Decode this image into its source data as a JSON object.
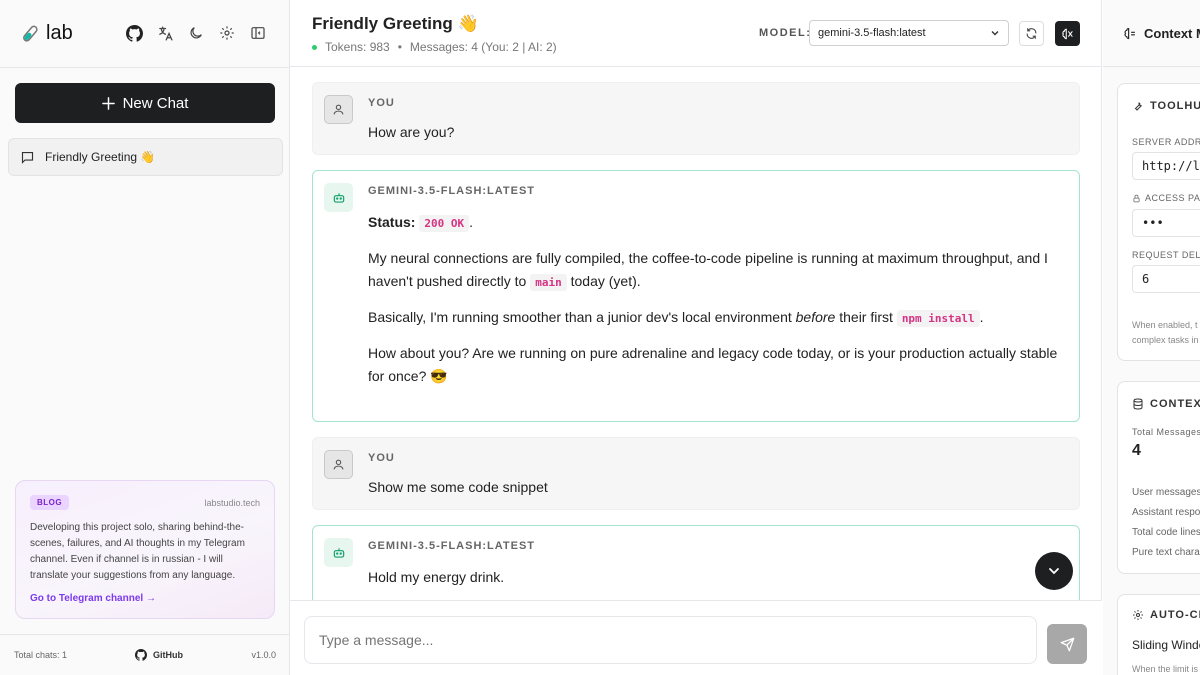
{
  "sidebar": {
    "brand": "lab",
    "new_chat": "New Chat",
    "chats": [
      {
        "title": "Friendly Greeting 👋"
      }
    ],
    "blog": {
      "badge": "BLOG",
      "site": "labstudio.tech",
      "text": "Developing this project solo, sharing behind-the-scenes, failures, and AI thoughts in my Telegram channel. Even if channel is in russian - I will translate your suggestions from any language.",
      "link": "Go to Telegram channel →"
    },
    "footer": {
      "total": "Total chats: 1",
      "github": "GitHub",
      "version": "v1.0.0"
    }
  },
  "header": {
    "title": "Friendly Greeting 👋",
    "tokens": "Tokens: 983",
    "messages": "Messages: 4 (You: 2 | AI: 2)",
    "model_label": "MODEL:",
    "model_value": "gemini-3.5-flash:latest"
  },
  "messages": [
    {
      "role": "YOU",
      "text": "How are you?"
    },
    {
      "role": "GEMINI-3.5-FLASH:LATEST",
      "status_label": "Status:",
      "status_code": "200 OK",
      "p1a": "My neural connections are fully compiled, the coffee-to-code pipeline is running at maximum throughput, and I haven't pushed directly to",
      "p1code": "main",
      "p1b": "today (yet).",
      "p2a": "Basically, I'm running smoother than a junior dev's local environment",
      "p2em": "before",
      "p2b": "their first",
      "p2code": "npm install",
      "p3": "How about you? Are we running on pure adrenaline and legacy code today, or is your production actually stable for once? 😎"
    },
    {
      "role": "YOU",
      "text": "Show me some code snippet"
    },
    {
      "role": "GEMINI-3.5-FLASH:LATEST",
      "text": "Hold my energy drink."
    }
  ],
  "input": {
    "placeholder": "Type a message..."
  },
  "right_panel": {
    "title": "Context M",
    "toolhub": {
      "title": "TOOLHUB",
      "server_label": "SERVER ADDRE",
      "server_value": "http://lo",
      "pass_label": "ACCESS PAS",
      "pass_value": "•••",
      "delay_label": "REQUEST DELA",
      "delay_value": "6",
      "hint1": "When enabled, t",
      "hint2": "complex tasks in"
    },
    "context": {
      "title": "CONTEXT",
      "total_label": "Total Messages",
      "total_value": "4",
      "user_msgs": "User messages",
      "assistant": "Assistant respo",
      "code_lines": "Total code lines",
      "pure_text": "Pure text chara"
    },
    "autoclean": {
      "title": "AUTO-CL",
      "sliding": "Sliding Windo",
      "hint": "When the limit is"
    }
  }
}
